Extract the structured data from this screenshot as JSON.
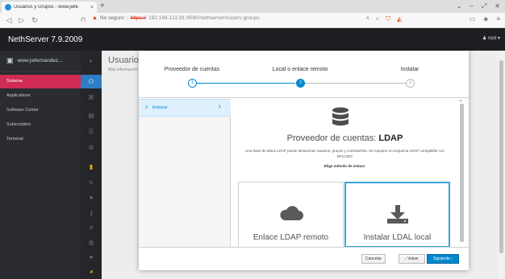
{
  "browser": {
    "tab_title": "Usuarios y Grupos - www.jwfe",
    "tab_close": "×",
    "new_tab": "+",
    "security_label": "No seguro",
    "url_scheme": "https://",
    "url_host": "192.168.122.81:9090/nethserver#/users-groups"
  },
  "header": {
    "brand": "NethServer 7.9.2009",
    "user": "root"
  },
  "sidebar": {
    "hostname": "www.jwfernandez...",
    "items": [
      {
        "label": "Sistema",
        "active": true
      },
      {
        "label": "Applications",
        "active": false
      },
      {
        "label": "Software Center",
        "active": false
      },
      {
        "label": "Subscription",
        "active": false
      },
      {
        "label": "Terminal",
        "active": false
      }
    ]
  },
  "page": {
    "title": "Usuarios",
    "subtitle": "Más información"
  },
  "wizard": {
    "steps": [
      {
        "label": "Proveedor de cuentas",
        "number": "1",
        "state": "done"
      },
      {
        "label": "Local o enlace remoto",
        "number": "2",
        "state": "current"
      },
      {
        "label": "Instalar",
        "number": "3",
        "state": "pending"
      }
    ],
    "substep": {
      "number": "2",
      "label": "Enlazar"
    },
    "content": {
      "title_prefix": "Proveedor de cuentas:",
      "title_strong": "LDAP",
      "description": "Una base de datos LDAP puede almacenar usuarios, grupos y contraseñas. Se requiere un esquema LDAP compatible con RFC2307",
      "choose_label": "Elige método de enlace:",
      "options": [
        {
          "label": "Enlace LDAP remoto",
          "icon": "cloud-icon",
          "selected": false
        },
        {
          "label": "Instalar LDAL local",
          "icon": "download-icon",
          "selected": true
        }
      ]
    },
    "buttons": {
      "cancel": "Cancelar",
      "back": "‹ Volver",
      "next": "Siguiente ›"
    }
  },
  "colors": {
    "accent": "#0088ce",
    "active_nav": "#cf2b54",
    "header_bg": "#1e1f22",
    "sidebar_bg": "#2a2c30"
  }
}
